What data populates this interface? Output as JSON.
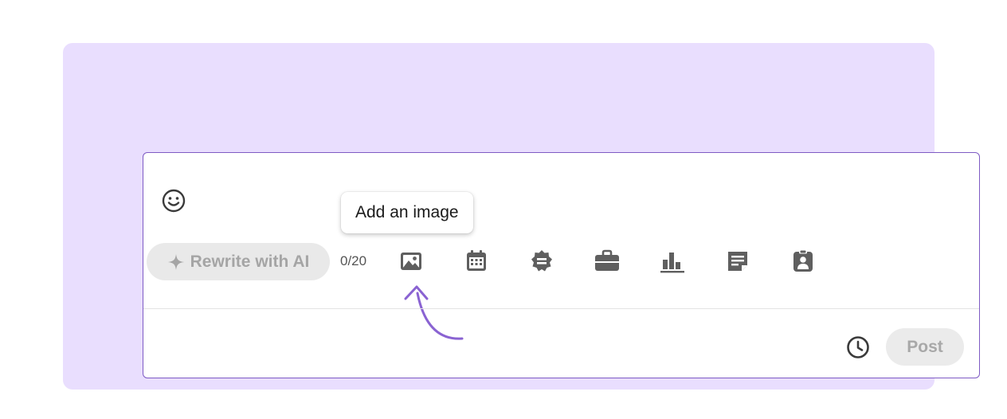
{
  "composer": {
    "tooltip": "Add an image",
    "ai_button_label": "Rewrite with AI",
    "char_counter": "0/20",
    "post_button_label": "Post"
  },
  "colors": {
    "panel_bg": "#e9defe",
    "accent": "#7e5bc4",
    "icon": "#5f5f5f"
  },
  "icons": [
    "emoji-icon",
    "sparkle-icon",
    "image-icon",
    "calendar-icon",
    "celebrate-icon",
    "briefcase-icon",
    "poll-icon",
    "document-icon",
    "expert-icon",
    "clock-icon",
    "pointer-arrow-icon"
  ]
}
